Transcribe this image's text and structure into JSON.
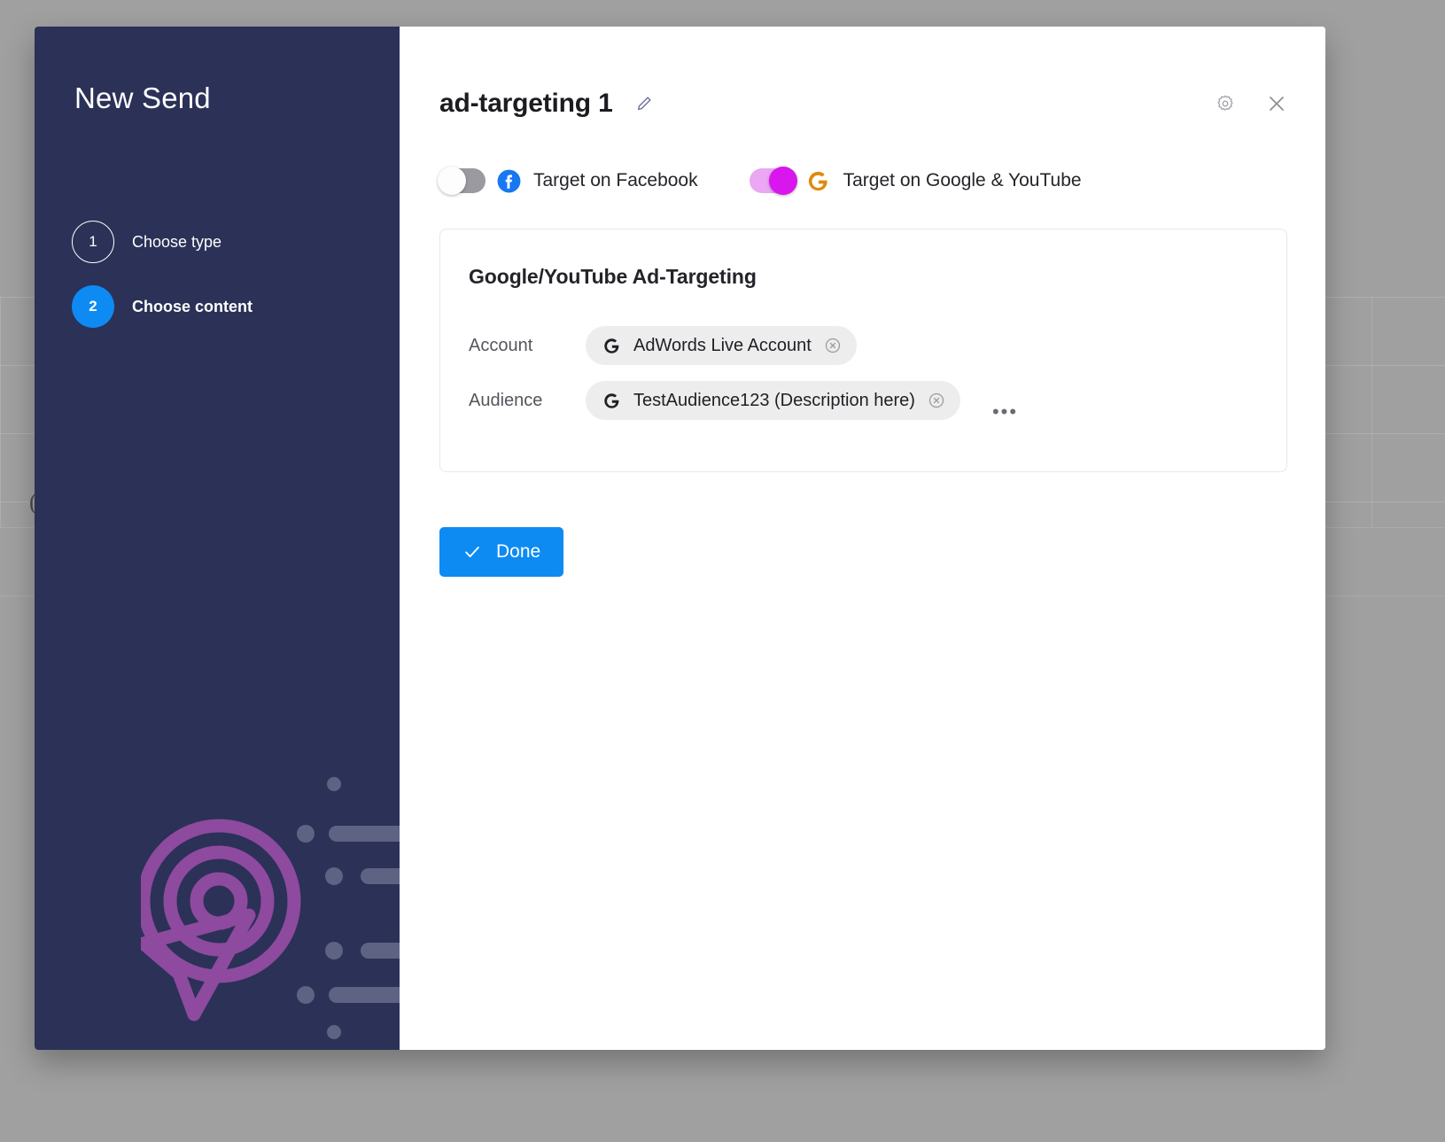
{
  "backdrop": {
    "partial_glyph": "("
  },
  "sidebar": {
    "title": "New Send",
    "steps": [
      {
        "number": "1",
        "label": "Choose type",
        "state": "pending"
      },
      {
        "number": "2",
        "label": "Choose content",
        "state": "active"
      }
    ],
    "background_color": "#2b3157",
    "active_step_color": "#0d8bf2",
    "artwork_color": "#8d4a9e",
    "artwork_name": "target-cursor-logo"
  },
  "header": {
    "title": "ad-targeting 1",
    "edit_icon": "pencil-icon",
    "settings_icon": "gear-icon",
    "close_icon": "close-icon"
  },
  "channels": [
    {
      "label": "Target on Facebook",
      "enabled": false,
      "icon": "facebook-icon",
      "icon_color": "#1877F2",
      "toggle_off_track": "#9a9aa0"
    },
    {
      "label": "Target on Google & YouTube",
      "enabled": true,
      "icon": "google-g-icon",
      "icon_color": "#E08A0B",
      "toggle_on_track": "#eba6f4",
      "toggle_on_knob": "#d916ed"
    }
  ],
  "card": {
    "title": "Google/YouTube Ad-Targeting",
    "fields": [
      {
        "label": "Account",
        "chip": {
          "icon": "google-g-icon",
          "text": "AdWords Live Account",
          "remove_icon": "circle-x-icon",
          "background": "#ededee"
        }
      },
      {
        "label": "Audience",
        "chip": {
          "icon": "google-g-icon",
          "text": "TestAudience123 (Description here)",
          "remove_icon": "circle-x-icon",
          "background": "#ededee"
        },
        "more_indicator": "•••"
      }
    ],
    "border_color": "#e4e7f2"
  },
  "footer": {
    "done_label": "Done",
    "done_icon": "check-icon",
    "done_color": "#0d8bf2"
  }
}
